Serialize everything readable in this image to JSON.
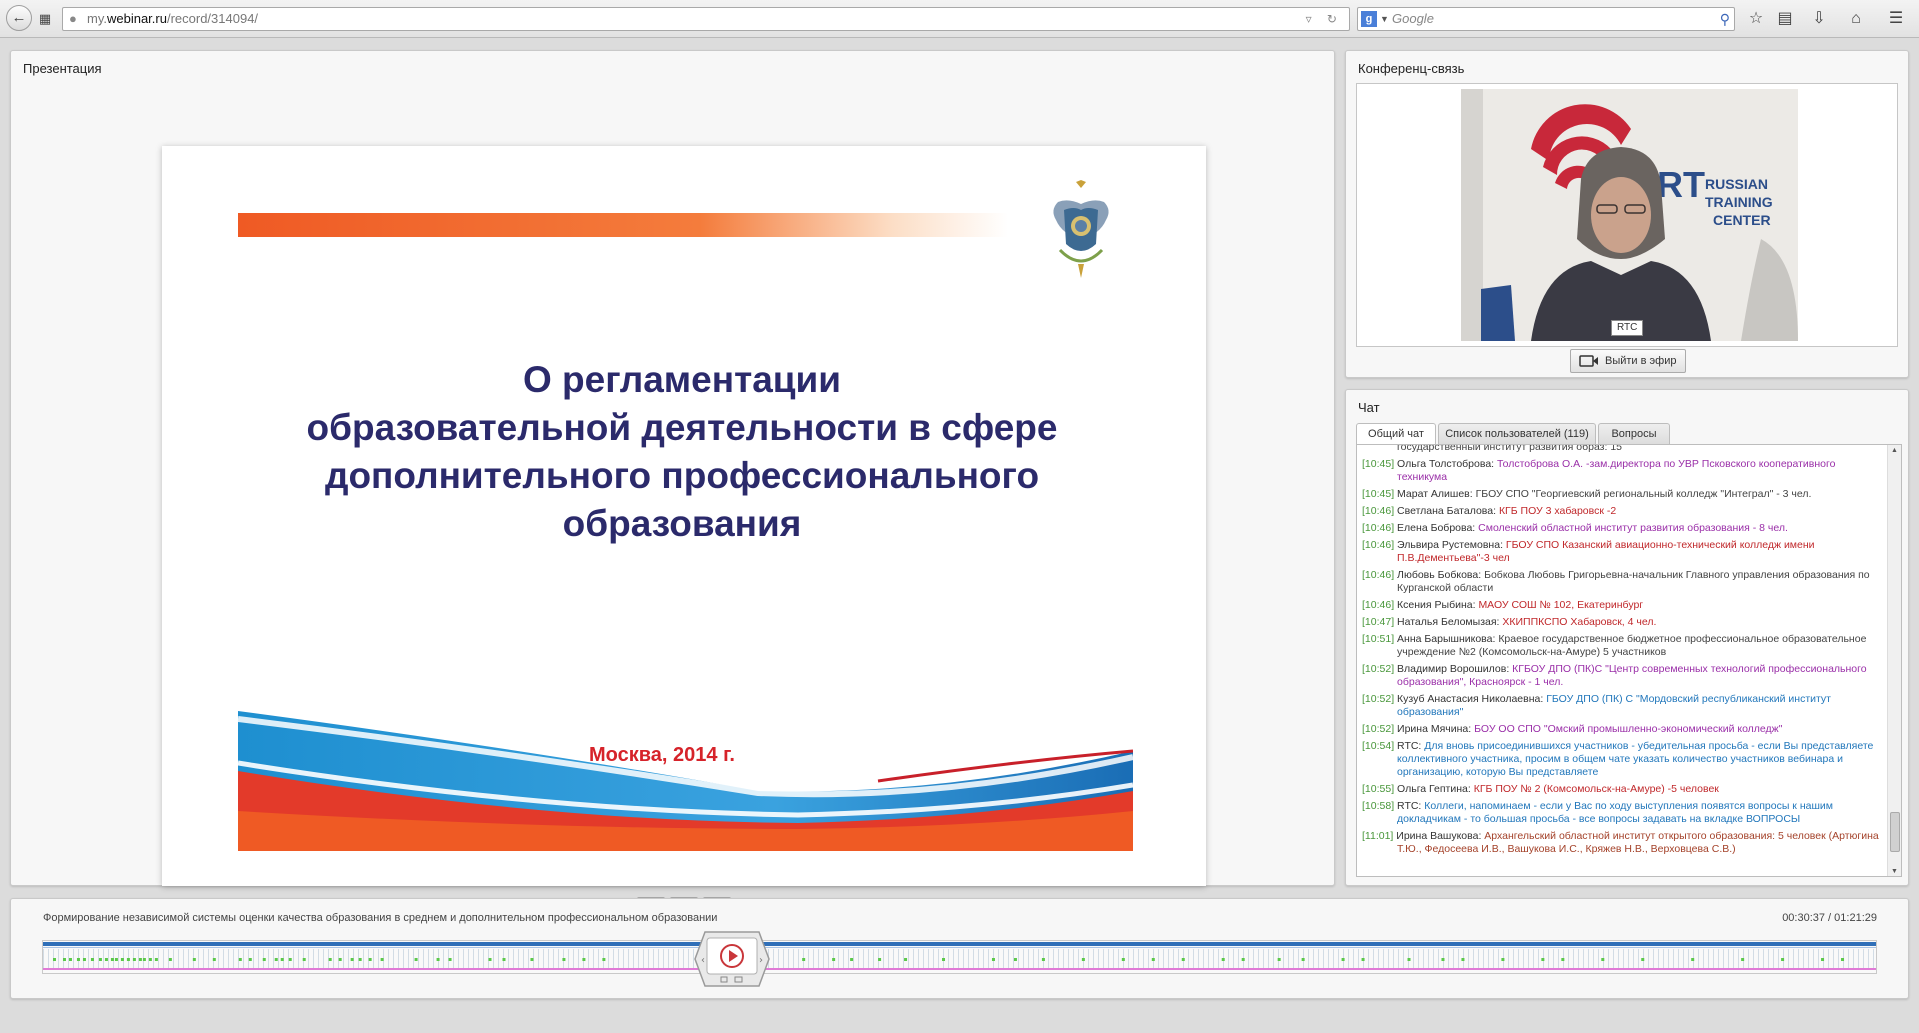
{
  "browser": {
    "url_prefix": "my.",
    "url_domain": "webinar.ru",
    "url_path": "/record/314094/",
    "search_engine_letter": "g",
    "search_placeholder": "Google"
  },
  "presentation": {
    "title": "Презентация",
    "slide": {
      "title_lines": [
        "О регламентации",
        "образовательной деятельности в сфере",
        "дополнительного профессионального",
        "образования"
      ],
      "place": "Москва,  2014 г."
    }
  },
  "conference": {
    "title": "Конференц-связь",
    "video_label": "RTC",
    "onair_button": "Выйти в эфир"
  },
  "chat": {
    "title": "Чат",
    "tabs": [
      {
        "label": "Общий чат",
        "active": true
      },
      {
        "label": "Список пользователей (119)",
        "active": false
      },
      {
        "label": "Вопросы",
        "active": false
      }
    ],
    "messages": [
      {
        "time": "",
        "user": "",
        "text": "государственный институт развития образ: 15",
        "color": "gray"
      },
      {
        "time": "[10:45]",
        "user": "Ольга Толстоброва:",
        "text": "Толстоброва О.А. -зам.директора по УВР Псковского кооперативного техникума",
        "color": "purple"
      },
      {
        "time": "[10:45]",
        "user": "Марат Алишев:",
        "text": "ГБОУ СПО \"Георгиевский региональный колледж \"Интеграл\" - 3 чел.",
        "color": "gray"
      },
      {
        "time": "[10:46]",
        "user": "Светлана Баталова:",
        "text": "КГБ ПОУ 3 хабаровск -2",
        "color": "red"
      },
      {
        "time": "[10:46]",
        "user": "Елена Боброва:",
        "text": "Смоленский областной институт развития образования - 8 чел.",
        "color": "purple"
      },
      {
        "time": "[10:46]",
        "user": "Эльвира Рустемовна:",
        "text": "ГБОУ СПО Казанский авиационно-технический колледж имени П.В.Дементьева\"-3 чел",
        "color": "red"
      },
      {
        "time": "[10:46]",
        "user": "Любовь Бобкова:",
        "text": "Бобкова Любовь Григорьевна-начальник Главного управления образования по Курганской области",
        "color": "gray"
      },
      {
        "time": "[10:46]",
        "user": "Ксения Рыбина:",
        "text": "МАОУ СОШ № 102, Екатеринбург",
        "color": "red"
      },
      {
        "time": "[10:47]",
        "user": "Наталья Беломызая:",
        "text": "ХКИППКСПО Хабаровск, 4 чел.",
        "color": "red"
      },
      {
        "time": "[10:51]",
        "user": "Анна Барышникова:",
        "text": "Краевое государственное бюджетное профессиональное образовательное учреждение №2 (Комсомольск-на-Амуре) 5 участников",
        "color": "gray"
      },
      {
        "time": "[10:52]",
        "user": "Владимир Ворошилов:",
        "text": "КГБОУ ДПО (ПК)С \"Центр современных технологий профессионального образования\", Красноярск - 1 чел.",
        "color": "purple"
      },
      {
        "time": "[10:52]",
        "user": "Кузуб Анастасия Николаевна:",
        "text": "ГБОУ ДПО (ПК) С \"Мордовский республиканский институт образования\"",
        "color": "blue"
      },
      {
        "time": "[10:52]",
        "user": "Ирина Мячина:",
        "text": "БОУ ОО СПО \"Омский промышленно-экономический колледж\"",
        "color": "purple"
      },
      {
        "time": "[10:54]",
        "user": "RTC:",
        "text": "Для вновь присоединившихся участников - убедительная просьба - если Вы представляете коллективного участника, просим в общем чате указать количество участников вебинара и организацию, которую Вы представляете",
        "color": "blue"
      },
      {
        "time": "[10:55]",
        "user": "Ольга Гептина:",
        "text": "КГБ ПОУ № 2 (Комсомольск-на-Амуре) -5 человек",
        "color": "red"
      },
      {
        "time": "[10:58]",
        "user": "RTC:",
        "text": "Коллеги, напоминаем - если у Вас по ходу выступления появятся вопросы к нашим докладчикам - то большая просьба - все вопросы задавать на вкладке ВОПРОСЫ",
        "color": "blue"
      },
      {
        "time": "[11:01]",
        "user": "Ирина Вашукова:",
        "text": "Архангельский областной институт открытого образования: 5 человек (Артюгина Т.Ю., Федосеева И.В., Вашукова И.С., Кряжев Н.В., Верховцева С.В.)",
        "color": "brown"
      }
    ]
  },
  "timeline": {
    "title": "Формирование независимой системы оценки качества образования в среднем и дополнительном профессиональном образовании",
    "time": "00:30:37 / 01:21:29",
    "progress_fraction": 0.376
  },
  "colors": {
    "slide_title": "#2b2a6b",
    "slide_bar": "#ef5a24",
    "slide_place": "#d6232a",
    "chat_time": "#48963a",
    "timeline_blue": "#2f6fb8",
    "timeline_pink": "#e07ad6"
  }
}
